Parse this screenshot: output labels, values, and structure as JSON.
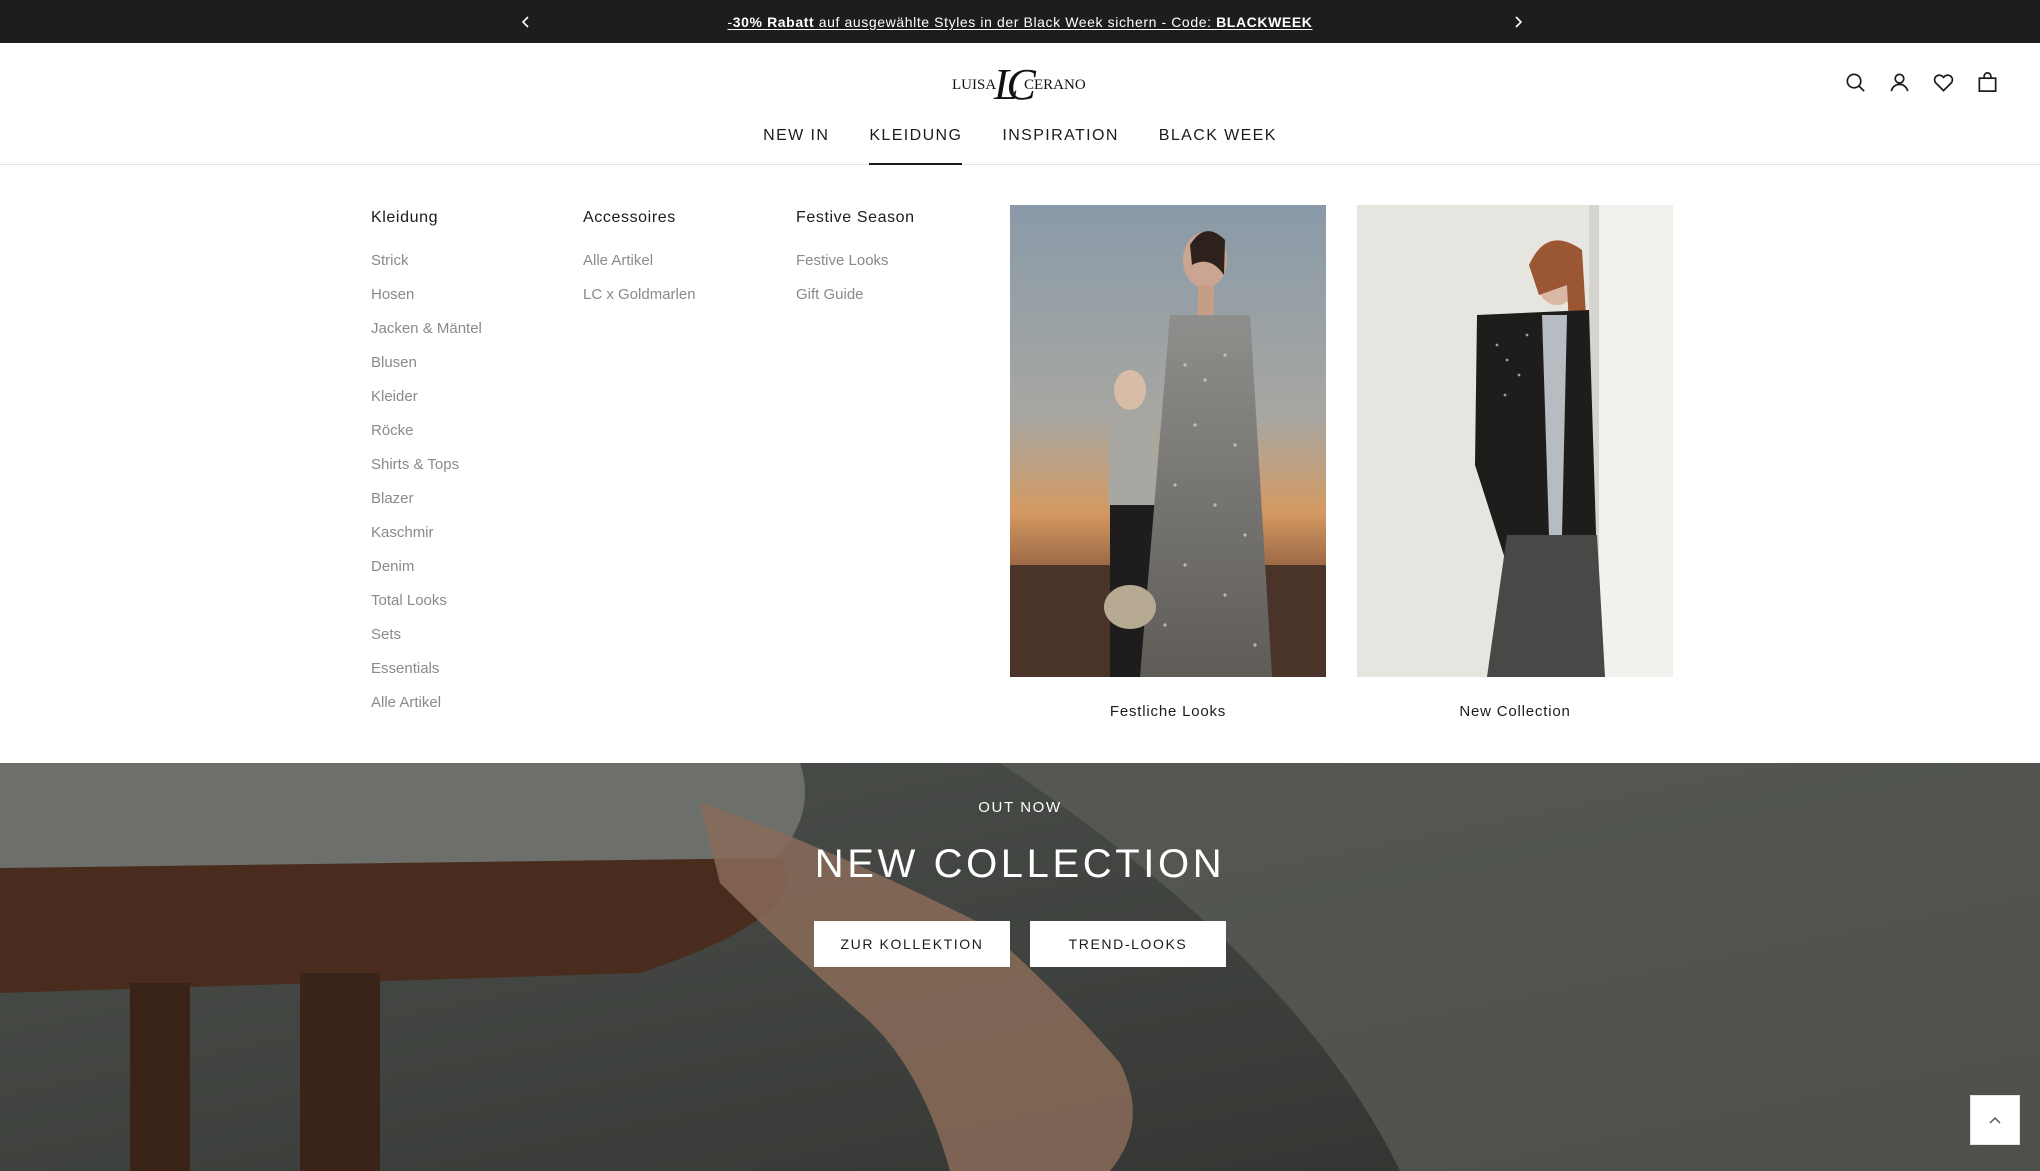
{
  "announcement": {
    "prefix": "-",
    "discount": "30% Rabatt",
    "middle": " auf ausgewählte Styles in der Black Week sichern - Code: ",
    "code": "BLACKWEEK",
    "prev_icon": "chevron-left-icon",
    "next_icon": "chevron-right-icon"
  },
  "header": {
    "logo_text_left": "LUISA",
    "logo_text_right": "CERANO",
    "logo_monogram": "LC",
    "icons": [
      "search-icon",
      "account-icon",
      "wishlist-heart-icon",
      "cart-bag-icon"
    ]
  },
  "nav": {
    "items": [
      {
        "label": "NEW IN"
      },
      {
        "label": "KLEIDUNG",
        "active": true
      },
      {
        "label": "INSPIRATION"
      },
      {
        "label": "BLACK WEEK"
      }
    ]
  },
  "mega": {
    "columns": [
      {
        "heading": "Kleidung",
        "links": [
          "Strick",
          "Hosen",
          "Jacken & Mäntel",
          "Blusen",
          "Kleider",
          "Röcke",
          "Shirts & Tops",
          "Blazer",
          "Kaschmir",
          "Denim",
          "Total Looks",
          "Sets",
          "Essentials",
          "Alle Artikel"
        ]
      },
      {
        "heading": "Accessoires",
        "links": [
          "Alle Artikel",
          "LC x Goldmarlen"
        ]
      },
      {
        "heading": "Festive Season",
        "links": [
          "Festive Looks",
          "Gift Guide"
        ]
      }
    ],
    "cards": [
      {
        "caption": "Festliche Looks"
      },
      {
        "caption": "New Collection"
      }
    ]
  },
  "hero": {
    "eyebrow": "OUT NOW",
    "title": "NEW COLLECTION",
    "button_primary": "ZUR KOLLEKTION",
    "button_secondary": "TREND-LOOKS"
  },
  "scroll_top_icon": "chevron-up-icon"
}
